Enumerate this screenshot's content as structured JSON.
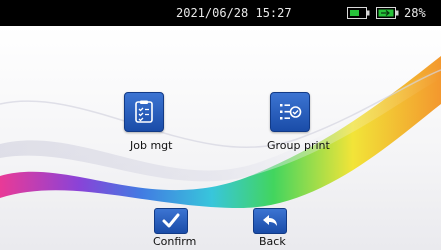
{
  "status_bar": {
    "datetime": "2021/06/28  15:27",
    "battery_percent": "28%",
    "icons": [
      "battery-icon",
      "charging-battery-icon"
    ],
    "accent_color": "#27c23a"
  },
  "menu": {
    "items": [
      {
        "label": "Job mgt",
        "icon": "clipboard-checklist-icon"
      },
      {
        "label": "Group print",
        "icon": "list-check-icon"
      }
    ]
  },
  "footer": {
    "confirm_label": "Confirm",
    "back_label": "Back",
    "confirm_icon": "checkmark-icon",
    "back_icon": "back-arrow-icon"
  },
  "colors": {
    "tile_blue": "#2257b8",
    "status_bar_bg": "#000000"
  }
}
